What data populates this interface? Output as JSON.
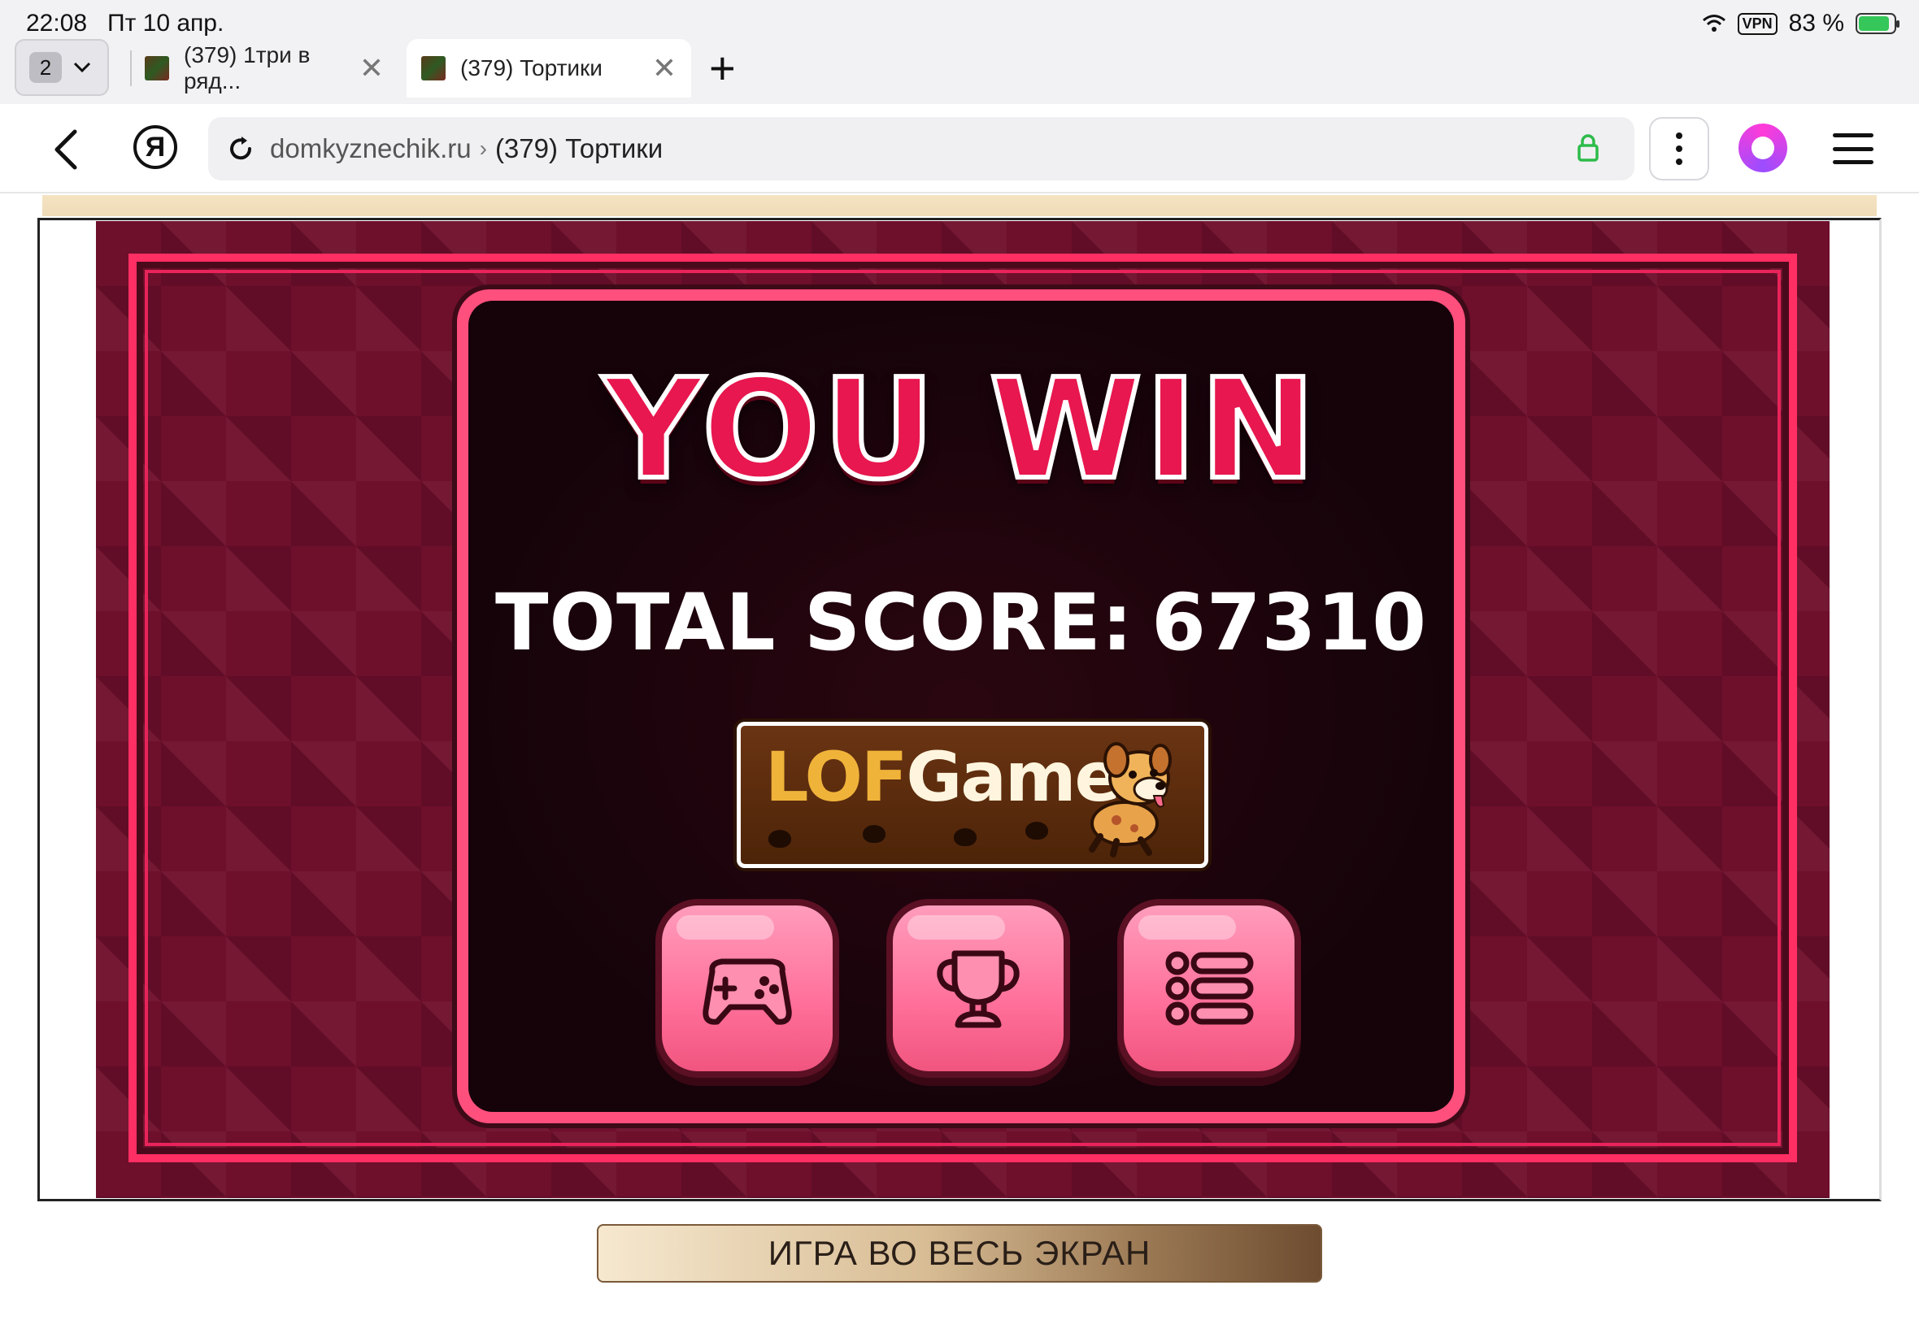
{
  "status_bar": {
    "time": "22:08",
    "date": "Пт 10 апр.",
    "vpn": "VPN",
    "battery": "83 %"
  },
  "tabs": {
    "count": "2",
    "items": [
      {
        "label": "(379) 1три в ряд..."
      },
      {
        "label": "(379) Тортики",
        "active": true
      }
    ]
  },
  "address_bar": {
    "yandex_letter": "Я",
    "domain": "domkyznechik.ru",
    "separator": "›",
    "page_title": "(379) Тортики"
  },
  "game": {
    "title": "YOU WIN",
    "score_label": "TOTAL SCORE:",
    "score_value": "67310",
    "logo_text_accent": "LOF",
    "logo_text_rest": "Games",
    "buttons": [
      {
        "name": "play",
        "icon": "gamepad-icon"
      },
      {
        "name": "leaderboard",
        "icon": "trophy-icon"
      },
      {
        "name": "menu",
        "icon": "list-icon"
      }
    ],
    "colors": {
      "background": "#6e0f2c",
      "frame": "#ff2e63",
      "title": "#e8174f",
      "button": "#ff6f99"
    }
  },
  "page": {
    "fullscreen_label": "ИГРА ВО ВЕСЬ ЭКРАН"
  }
}
